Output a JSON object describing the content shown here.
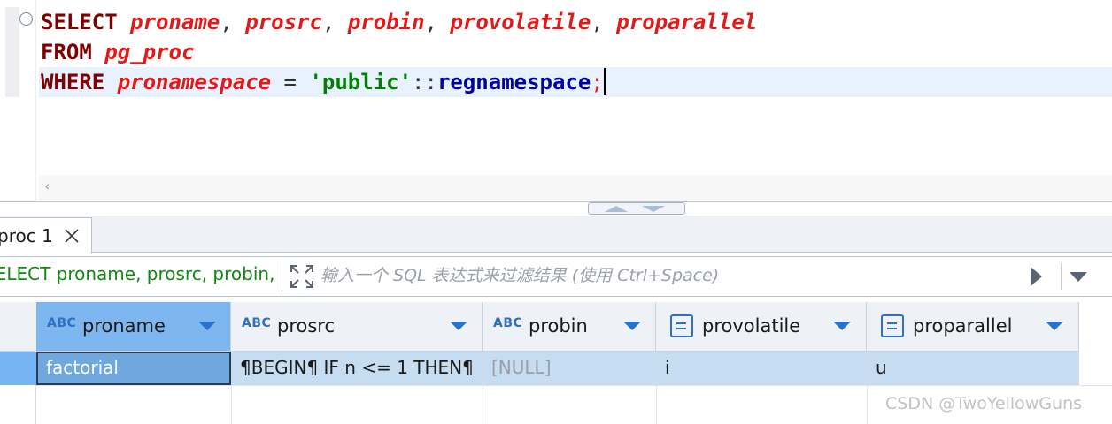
{
  "editor": {
    "lines": [
      [
        {
          "t": "SELECT",
          "c": "kw"
        },
        {
          "t": " ",
          "c": "op"
        },
        {
          "t": "proname",
          "c": "id"
        },
        {
          "t": ", ",
          "c": "op"
        },
        {
          "t": "prosrc",
          "c": "id"
        },
        {
          "t": ", ",
          "c": "op"
        },
        {
          "t": "probin",
          "c": "id"
        },
        {
          "t": ", ",
          "c": "op"
        },
        {
          "t": "provolatile",
          "c": "id"
        },
        {
          "t": ", ",
          "c": "op"
        },
        {
          "t": "proparallel",
          "c": "id"
        }
      ],
      [
        {
          "t": "FROM",
          "c": "kw"
        },
        {
          "t": " ",
          "c": "op"
        },
        {
          "t": "pg_proc",
          "c": "id"
        }
      ],
      [
        {
          "t": "WHERE",
          "c": "kw"
        },
        {
          "t": " ",
          "c": "op"
        },
        {
          "t": "pronamespace",
          "c": "id"
        },
        {
          "t": " = ",
          "c": "op"
        },
        {
          "t": "'public'",
          "c": "str"
        },
        {
          "t": "::",
          "c": "op"
        },
        {
          "t": "regnamespace",
          "c": "tp"
        },
        {
          "t": ";",
          "c": "sc"
        }
      ]
    ],
    "scroll_left_icon": "chevron-left-icon"
  },
  "results": {
    "tab_label": "proc 1",
    "query_text": "SELECT proname, prosrc, probin, p",
    "filter_placeholder": "输入一个 SQL 表达式来过滤结果 (使用 Ctrl+Space)",
    "columns": [
      {
        "name": "proname",
        "type_icon": "ABC"
      },
      {
        "name": "prosrc",
        "type_icon": "ABC"
      },
      {
        "name": "probin",
        "type_icon": "ABC"
      },
      {
        "name": "provolatile",
        "type_icon": "doc"
      },
      {
        "name": "proparallel",
        "type_icon": "doc"
      }
    ],
    "rows": [
      [
        "factorial",
        "¶BEGIN¶    IF n <= 1 THEN¶",
        "[NULL]",
        "i",
        "u"
      ]
    ]
  },
  "watermark": "CSDN @TwoYellowGuns",
  "colors": {
    "keyword": "#7f0000",
    "identifier": "#e01919",
    "string": "#008000",
    "type": "#0000a0",
    "selection": "#c6dcf0",
    "focused_cell": "#6fa8df"
  }
}
